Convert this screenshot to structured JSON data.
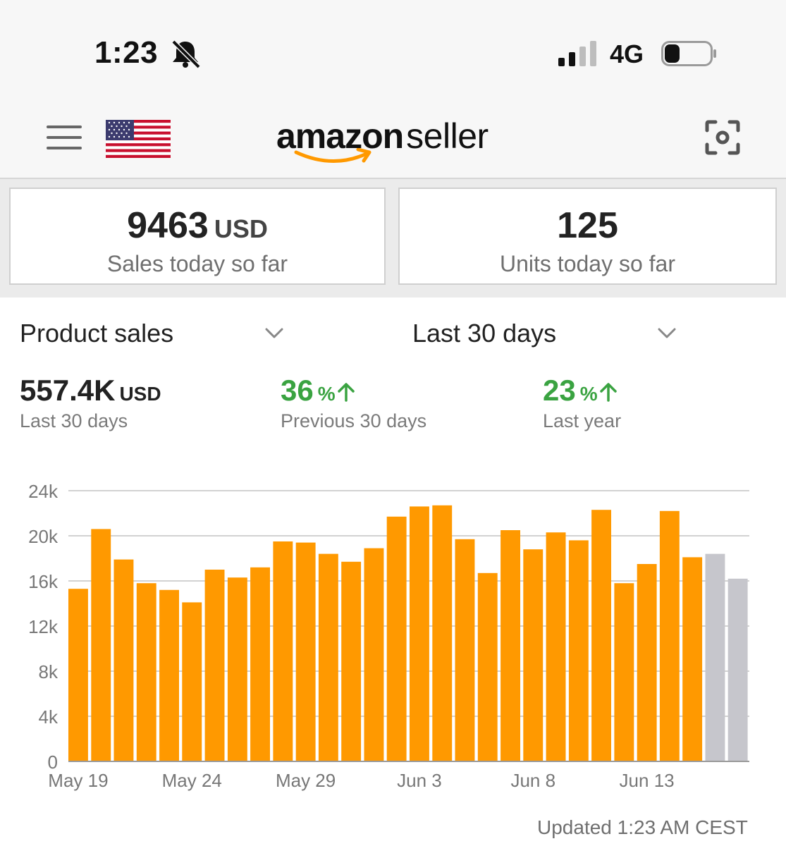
{
  "status_bar": {
    "time": "1:23",
    "network": "4G",
    "silent_icon": "bell-slash-icon",
    "signal_bars": 2,
    "signal_bars_total": 4,
    "battery_level": 0.2
  },
  "header": {
    "logo_bold": "amazon",
    "logo_light": "seller",
    "menu_icon": "hamburger-icon",
    "flag_icon": "us-flag-icon",
    "scan_icon": "scan-icon",
    "accent": "#ff9900"
  },
  "cards": {
    "sales": {
      "value": "9463",
      "unit": "USD",
      "label": "Sales today so far"
    },
    "units": {
      "value": "125",
      "label": "Units today so far"
    }
  },
  "filters": {
    "metric": "Product sales",
    "range": "Last 30 days"
  },
  "metrics": {
    "total": {
      "value": "557.4K",
      "unit": "USD",
      "label": "Last 30 days"
    },
    "prev": {
      "value": "36",
      "unit": "%",
      "label": "Previous 30 days"
    },
    "year": {
      "value": "23",
      "unit": "%",
      "label": "Last year"
    }
  },
  "chart_data": {
    "type": "bar",
    "ylim": [
      0,
      24000
    ],
    "yticks": [
      0,
      4000,
      8000,
      12000,
      16000,
      20000,
      24000
    ],
    "ytick_labels": [
      "0",
      "4k",
      "8k",
      "12k",
      "16k",
      "20k",
      "24k"
    ],
    "xtick_labels": [
      "May 19",
      "May 24",
      "May 29",
      "Jun 3",
      "Jun 8",
      "Jun 13"
    ],
    "xtick_indices": [
      0,
      5,
      10,
      15,
      20,
      25
    ],
    "values": [
      15300,
      20600,
      17900,
      15800,
      15200,
      14100,
      17000,
      16300,
      17200,
      19500,
      19400,
      18400,
      17700,
      18900,
      21700,
      22600,
      22700,
      19700,
      16700,
      20500,
      18800,
      20300,
      19600,
      22300,
      15800,
      17500,
      22200,
      18100,
      18400,
      16200
    ],
    "bar_colors": {
      "current": "#ff9900",
      "comparison": "#c6c6cc"
    },
    "comparison_from_index": 28,
    "grid": true
  },
  "footer": {
    "updated": "Updated 1:23 AM CEST"
  }
}
